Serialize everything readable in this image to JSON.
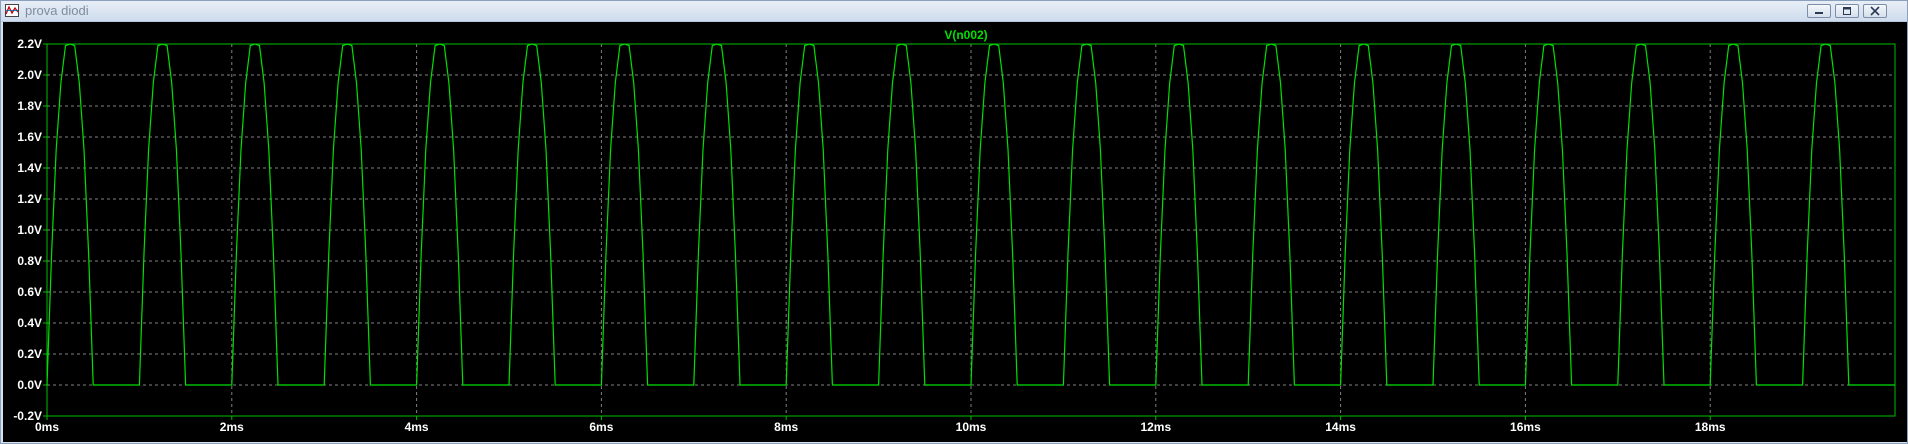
{
  "window": {
    "title": "prova diodi",
    "controls": [
      "minimize",
      "restore",
      "close"
    ]
  },
  "colors": {
    "trace": "#00e000",
    "grid": "#808080",
    "axis_text": "#ffffff",
    "frame": "#00c000",
    "background": "#000000"
  },
  "chart_data": {
    "type": "line",
    "title": "V(n002)",
    "series": [
      {
        "name": "V(n002)",
        "x": [
          0,
          0.05,
          0.1,
          0.15,
          0.2,
          0.25,
          0.3,
          0.35,
          0.4,
          0.45,
          0.5,
          0.55,
          0.6,
          0.65,
          0.7,
          0.75,
          0.8,
          0.85,
          0.9,
          0.95,
          1.0
        ],
        "y": [
          0,
          0.85,
          1.52,
          1.95,
          2.19,
          2.2,
          2.19,
          1.95,
          1.52,
          0.85,
          0,
          0,
          0,
          0,
          0,
          0,
          0,
          0,
          0,
          0,
          0
        ],
        "note_period_ms": 1.0,
        "note_cycles": 20
      }
    ],
    "xlim": [
      0,
      20
    ],
    "ylim": [
      -0.2,
      2.2
    ],
    "xunit": "ms",
    "yunit": "V",
    "xticks": [
      "0ms",
      "2ms",
      "4ms",
      "6ms",
      "8ms",
      "10ms",
      "12ms",
      "14ms",
      "16ms",
      "18ms"
    ],
    "xtick_values": [
      0,
      2,
      4,
      6,
      8,
      10,
      12,
      14,
      16,
      18
    ],
    "yticks": [
      "2.2V",
      "2.0V",
      "1.8V",
      "1.6V",
      "1.4V",
      "1.2V",
      "1.0V",
      "0.8V",
      "0.6V",
      "0.4V",
      "0.2V",
      "0.0V",
      "-0.2V"
    ],
    "ytick_values": [
      2.2,
      2.0,
      1.8,
      1.6,
      1.4,
      1.2,
      1.0,
      0.8,
      0.6,
      0.4,
      0.2,
      0.0,
      -0.2
    ],
    "grid": true
  }
}
